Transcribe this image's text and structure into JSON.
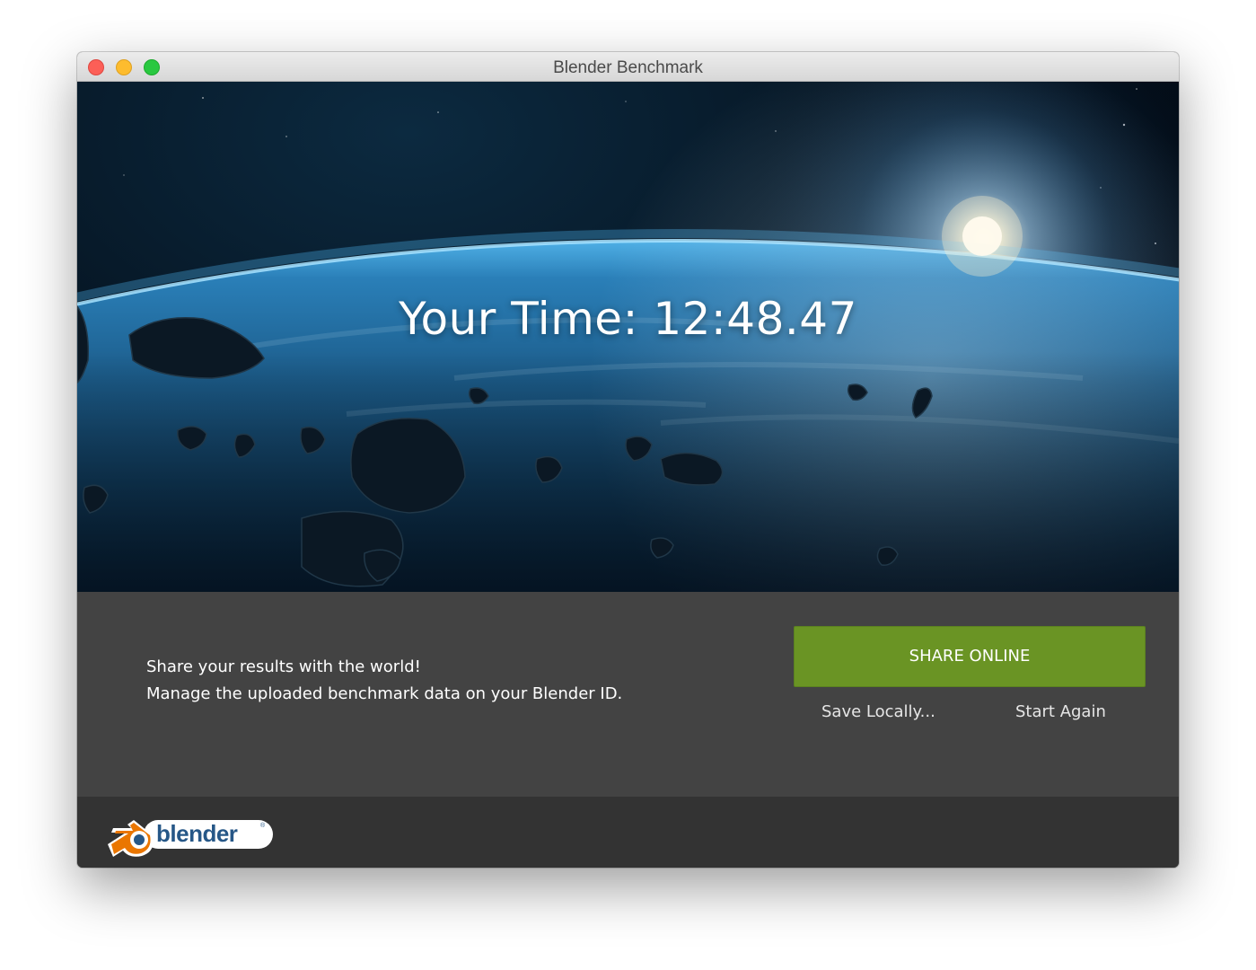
{
  "window": {
    "title": "Blender Benchmark",
    "controls": [
      "close",
      "minimize",
      "maximize"
    ]
  },
  "hero": {
    "time_label": "Your Time: 12:48.47"
  },
  "panel": {
    "message_line1": "Share your results with the world!",
    "message_line2": "Manage the uploaded benchmark data on your Blender ID.",
    "share_button": "SHARE ONLINE",
    "save_button": "Save Locally...",
    "restart_button": "Start Again"
  },
  "footer": {
    "logo_text": "blender",
    "logo_mark": "®"
  },
  "colors": {
    "share_button": "#6a9424",
    "panel_bg": "#434343",
    "footer_bg": "#333333",
    "logo_orange": "#ea7600",
    "logo_blue": "#265787"
  }
}
